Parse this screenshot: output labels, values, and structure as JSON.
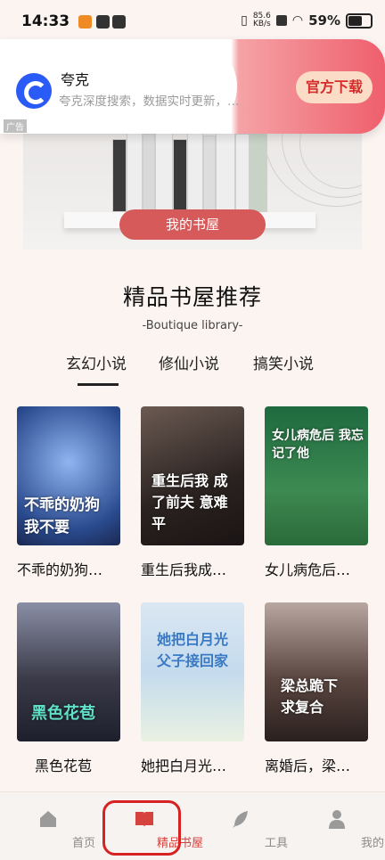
{
  "status_bar": {
    "time": "14:33",
    "speed": "85.6",
    "speed_unit": "KB/s",
    "battery": "59%"
  },
  "ad": {
    "title": "夸克",
    "description": "夸克深度搜索，数据实时更新，…",
    "button": "官方下载",
    "tag": "广告"
  },
  "hero": {
    "button": "我的书屋"
  },
  "section": {
    "title": "精品书屋推荐",
    "subtitle": "-Boutique library-"
  },
  "tabs": [
    {
      "label": "玄幻小说"
    },
    {
      "label": "修仙小说"
    },
    {
      "label": "搞笑小说"
    }
  ],
  "books": [
    {
      "title": "不乖的奶狗…",
      "cover_text": "不乖的奶狗 我不要"
    },
    {
      "title": "重生后我成…",
      "cover_text": "重生后我 成了前夫 意难平"
    },
    {
      "title": "女儿病危后…",
      "cover_text": "女儿病危后 我忘记了他"
    },
    {
      "title": "黑色花苞",
      "cover_text": "黑色花苞"
    },
    {
      "title": "她把白月光…",
      "cover_text": "她把白月光 父子接回家"
    },
    {
      "title": "离婚后，梁…",
      "cover_text": "梁总跪下 求复合"
    }
  ],
  "nav": [
    {
      "label": "首页",
      "icon": "home-icon"
    },
    {
      "label": "精品书屋",
      "icon": "book-open-icon"
    },
    {
      "label": "工具",
      "icon": "feather-icon"
    },
    {
      "label": "我的",
      "icon": "user-icon"
    }
  ]
}
